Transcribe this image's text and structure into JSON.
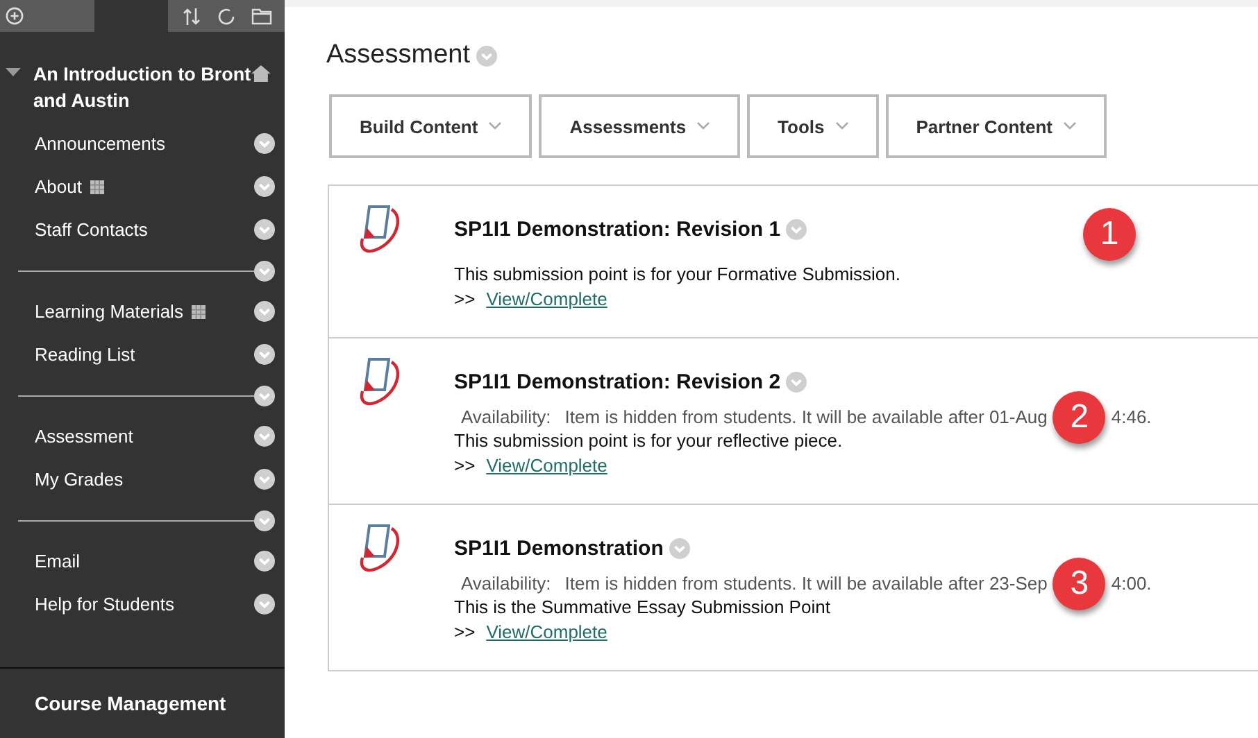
{
  "sidebar": {
    "course_title": "An Introduction to Bront and Austin",
    "items": [
      {
        "kind": "link",
        "label": "Announcements",
        "grid_icon": false
      },
      {
        "kind": "link",
        "label": "About",
        "grid_icon": true
      },
      {
        "kind": "link",
        "label": "Staff Contacts",
        "grid_icon": false
      },
      {
        "kind": "divider"
      },
      {
        "kind": "link",
        "label": "Learning Materials",
        "grid_icon": true
      },
      {
        "kind": "link",
        "label": "Reading List",
        "grid_icon": false
      },
      {
        "kind": "divider"
      },
      {
        "kind": "link",
        "label": "Assessment",
        "grid_icon": false
      },
      {
        "kind": "link",
        "label": "My Grades",
        "grid_icon": false
      },
      {
        "kind": "divider"
      },
      {
        "kind": "link",
        "label": "Email",
        "grid_icon": false
      },
      {
        "kind": "link",
        "label": "Help for Students",
        "grid_icon": false
      }
    ],
    "footer_title": "Course Management"
  },
  "page_title": "Assessment",
  "action_bar": [
    "Build Content",
    "Assessments",
    "Tools",
    "Partner Content"
  ],
  "items": [
    {
      "title": "SP1I1 Demonstration: Revision 1",
      "description": "This submission point is for your Formative Submission.",
      "link_prefix": ">>",
      "link": "View/Complete",
      "callout": "1"
    },
    {
      "title": "SP1I1 Demonstration: Revision 2",
      "availability_label": "Availability:",
      "availability": "Item is hidden from students. It will be available after 01-Aug",
      "availability_tail": "4:46.",
      "description": "This submission point is for your reflective piece.",
      "link_prefix": ">>",
      "link": "View/Complete",
      "callout": "2"
    },
    {
      "title": "SP1I1 Demonstration",
      "availability_label": "Availability:",
      "availability": "Item is hidden from students. It will be available after 23-Sep",
      "availability_tail": "4:00.",
      "description": "This is the Summative Essay Submission Point",
      "link_prefix": ">>",
      "link": "View/Complete",
      "callout": "3"
    }
  ]
}
